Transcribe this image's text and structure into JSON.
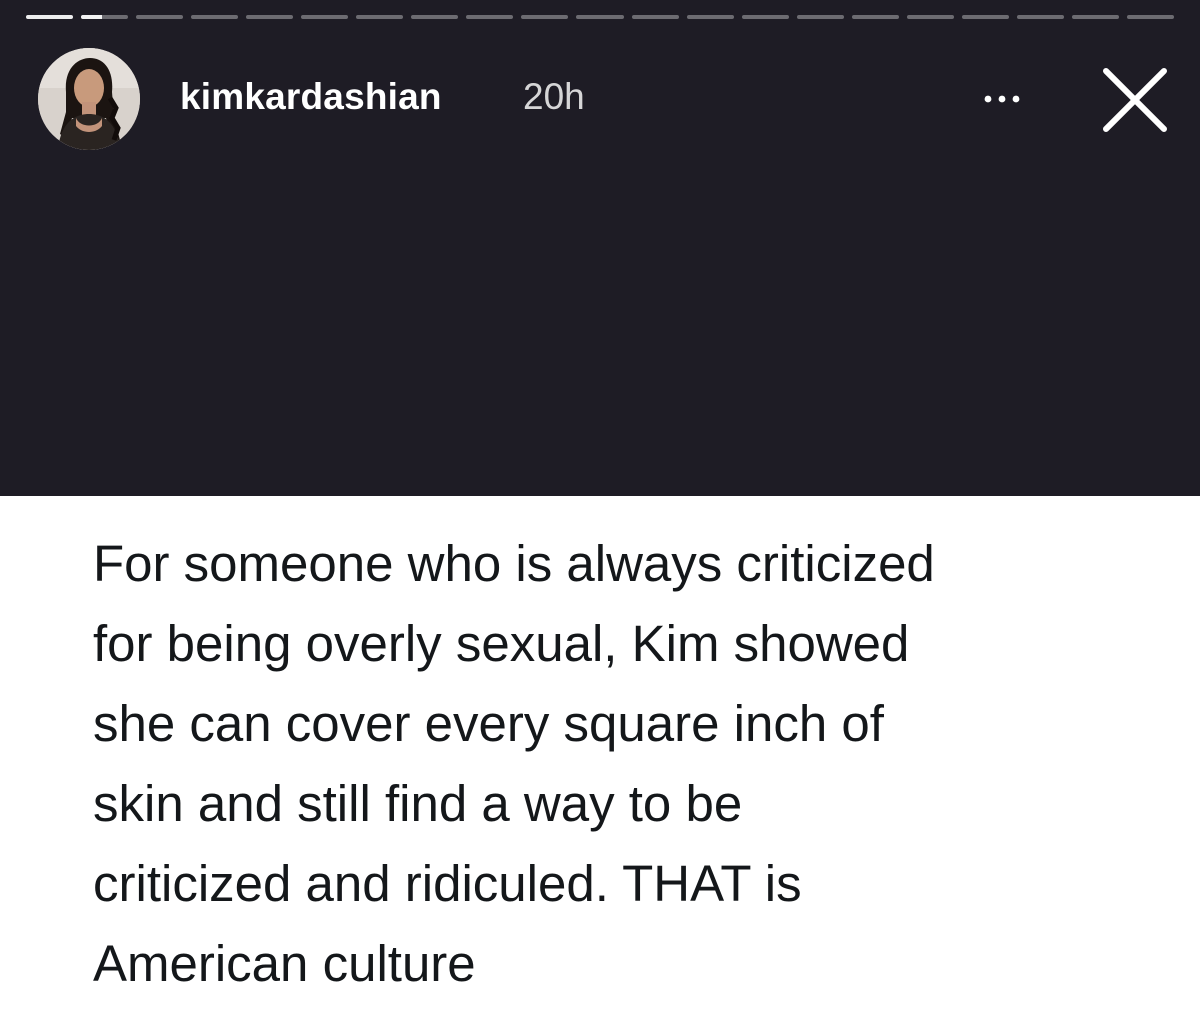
{
  "story": {
    "progress": {
      "total_segments": 21,
      "current_segment": 2,
      "current_fraction": 0.45
    },
    "header": {
      "username": "kimkardashian",
      "timestamp": "20h",
      "avatar_icon": "profile-photo",
      "more_icon": "more-horizontal-icon",
      "close_icon": "close-icon"
    },
    "content": {
      "text": "For someone who is always criticized\nfor being overly sexual, Kim showed\nshe can cover every square inch of\nskin and still find a way to be\ncriticized and ridiculed. THAT is\nAmerican culture"
    },
    "colors": {
      "top_background": "#1e1c25",
      "text": "#14171a"
    }
  }
}
